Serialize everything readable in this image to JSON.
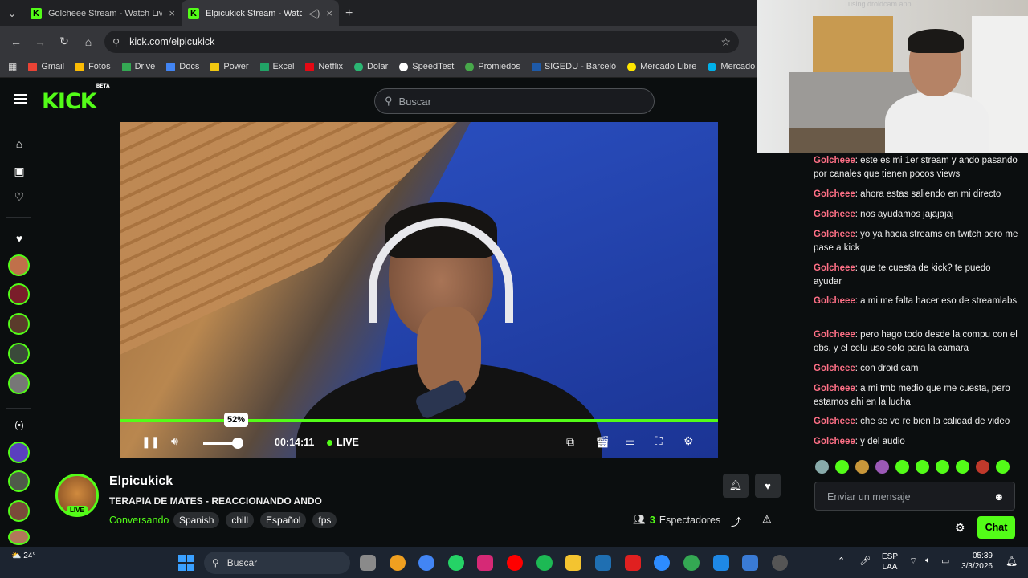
{
  "browser": {
    "tabs": [
      {
        "title": "Golcheee Stream - Watch Live o",
        "active": false
      },
      {
        "title": "Elpicukick Stream - Watch L",
        "active": true
      }
    ],
    "url": "kick.com/elpicukick",
    "bookmarks": [
      {
        "label": "Gmail",
        "color": "#ea4335"
      },
      {
        "label": "Fotos",
        "color": "#fbbc04"
      },
      {
        "label": "Drive",
        "color": "#34a853"
      },
      {
        "label": "Docs",
        "color": "#4285f4"
      },
      {
        "label": "Power",
        "color": "#f2c811"
      },
      {
        "label": "Excel",
        "color": "#21a366"
      },
      {
        "label": "Netflix",
        "color": "#e50914"
      },
      {
        "label": "Dolar",
        "color": "#2bb673"
      },
      {
        "label": "SpeedTest",
        "color": "#ffffff"
      },
      {
        "label": "Promiedos",
        "color": "#47a84a"
      },
      {
        "label": "SIGEDU - Barceló",
        "color": "#1e5aa8"
      },
      {
        "label": "Mercado Libre",
        "color": "#ffe600"
      },
      {
        "label": "Mercado Pago",
        "color": "#00b1ea"
      }
    ]
  },
  "kick": {
    "logo": "KICK",
    "logo_badge": "BETA",
    "search_placeholder": "Buscar",
    "accent": "#53fc18"
  },
  "player": {
    "volume_tooltip": "52%",
    "volume_level": 0.52,
    "time": "00:14:11",
    "live_label": "LIVE"
  },
  "channel": {
    "name": "Elpicukick",
    "title": "TERAPIA DE MATES - REACCIONANDO ANDO",
    "category": "Conversando",
    "tags": [
      "Spanish",
      "chill",
      "Español",
      "fps"
    ],
    "live_badge": "LIVE",
    "viewer_count": "3",
    "viewer_label": "Espectadores"
  },
  "chat": {
    "messages": [
      {
        "user": "Golcheee",
        "text": ": este es mi 1er stream y ando pasando por canales que tienen pocos views"
      },
      {
        "user": "Golcheee",
        "text": ": ahora estas saliendo en mi directo"
      },
      {
        "user": "Golcheee",
        "text": ": nos ayudamos jajajajaj"
      },
      {
        "user": "Golcheee",
        "text": ": yo ya hacia streams en twitch pero me pase a kick"
      },
      {
        "user": "Golcheee",
        "text": ": que te cuesta de kick? te puedo ayudar"
      },
      {
        "user": "Golcheee",
        "text": ": a mi me falta hacer eso de streamlabs"
      },
      {
        "user": "Golcheee",
        "text": ": pero hago todo desde la compu con el obs, y el celu uso solo para la camara"
      },
      {
        "user": "Golcheee",
        "text": ": con droid cam"
      },
      {
        "user": "Golcheee",
        "text": ": a mi tmb medio que me cuesta, pero estamos ahi en la lucha"
      },
      {
        "user": "Golcheee",
        "text": ": che se ve re bien la calidad de video"
      },
      {
        "user": "Golcheee",
        "text": ": y del audio"
      }
    ],
    "input_placeholder": "Enviar un mensaje",
    "send_label": "Chat"
  },
  "webcam": {
    "watermark": "using droidcam.app"
  },
  "taskbar": {
    "weather": "24°",
    "search_placeholder": "Buscar",
    "lang_line1": "ESP",
    "lang_line2": "LAA",
    "time": "05:39",
    "date": "3/3/2026"
  }
}
